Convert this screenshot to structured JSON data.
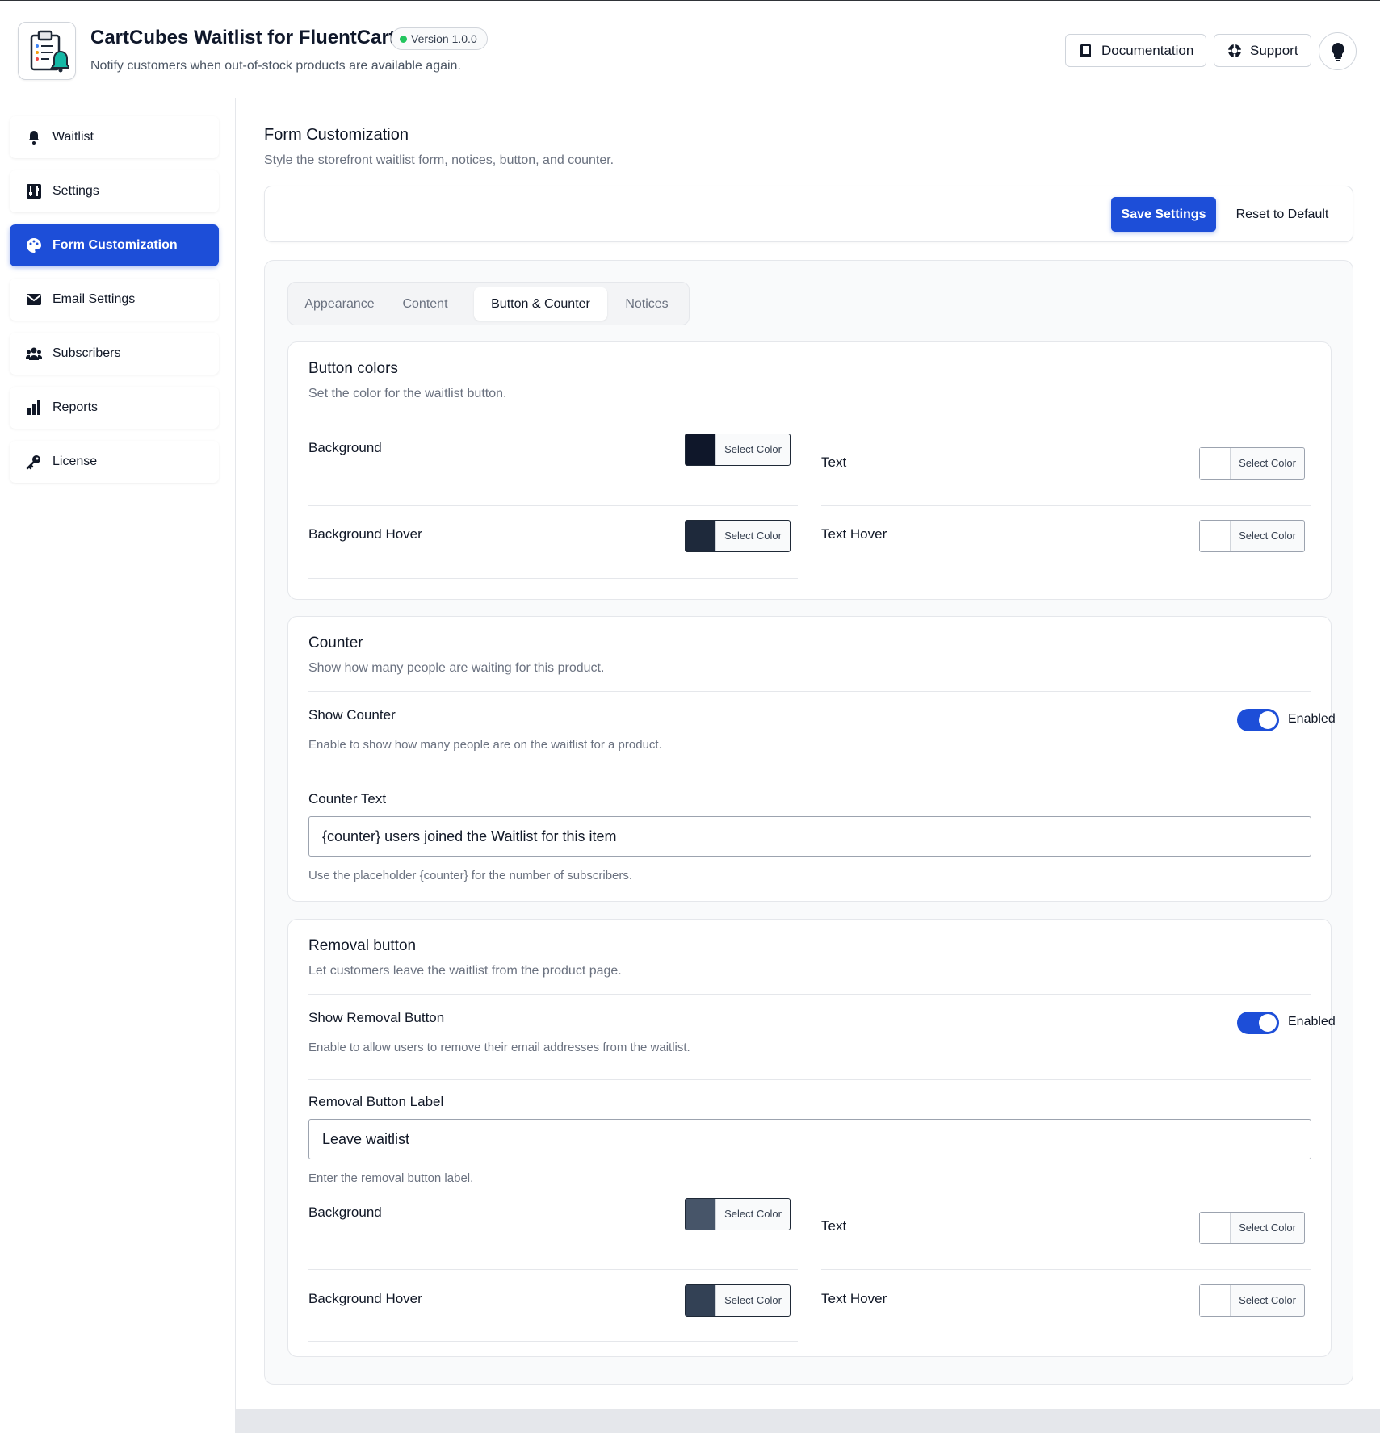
{
  "header": {
    "title": "CartCubes Waitlist for FluentCart",
    "version": "Version 1.0.0",
    "subtitle": "Notify customers when out-of-stock products are available again.",
    "docs_label": "Documentation",
    "support_label": "Support",
    "logo_icon": "clipboard-bell-icon",
    "bulb_icon": "lightbulb-icon"
  },
  "sidebar": {
    "items": [
      {
        "label": "Waitlist",
        "icon": "bell-icon"
      },
      {
        "label": "Settings",
        "icon": "sliders-icon"
      },
      {
        "label": "Form Customization",
        "icon": "palette-icon",
        "active": true
      },
      {
        "label": "Email Settings",
        "icon": "envelope-icon"
      },
      {
        "label": "Subscribers",
        "icon": "users-icon"
      },
      {
        "label": "Reports",
        "icon": "bar-chart-icon"
      },
      {
        "label": "License",
        "icon": "key-icon"
      }
    ]
  },
  "page": {
    "title": "Form Customization",
    "subtitle": "Style the storefront waitlist form, notices, button, and counter.",
    "save_label": "Save Settings",
    "reset_label": "Reset to Default"
  },
  "tabs": [
    {
      "label": "Appearance"
    },
    {
      "label": "Content"
    },
    {
      "label": "Button & Counter",
      "active": true
    },
    {
      "label": "Notices"
    }
  ],
  "button_colors": {
    "title": "Button colors",
    "subtitle": "Set the color for the waitlist button.",
    "background_label": "Background",
    "background_color": "#0f172a",
    "text_label": "Text",
    "text_color": "#ffffff",
    "bg_hover_label": "Background Hover",
    "bg_hover_color": "#1e293b",
    "text_hover_label": "Text Hover",
    "text_hover_color": "#ffffff",
    "select_label": "Select Color"
  },
  "counter": {
    "title": "Counter",
    "subtitle": "Show how many people are waiting for this product.",
    "show_label": "Show Counter",
    "show_state": "Enabled",
    "show_help": "Enable to show how many people are on the waitlist for a product.",
    "text_label": "Counter Text",
    "text_value": "{counter} users joined the Waitlist for this item",
    "text_help": "Use the placeholder {counter} for the number of subscribers."
  },
  "removal": {
    "title": "Removal button",
    "subtitle": "Let customers leave the waitlist from the product page.",
    "show_label": "Show Removal Button",
    "show_state": "Enabled",
    "show_help": "Enable to allow users to remove their email addresses from the waitlist.",
    "label_label": "Removal Button Label",
    "label_value": "Leave waitlist",
    "label_help": "Enter the removal button label.",
    "background_label": "Background",
    "background_color": "#475569",
    "text_label": "Text",
    "text_color": "#ffffff",
    "bg_hover_label": "Background Hover",
    "bg_hover_color": "#334155",
    "text_hover_label": "Text Hover",
    "text_hover_color": "#ffffff",
    "select_label": "Select Color"
  },
  "colors": {
    "primary": "#1d4ed8",
    "status_green": "#22c55e"
  }
}
